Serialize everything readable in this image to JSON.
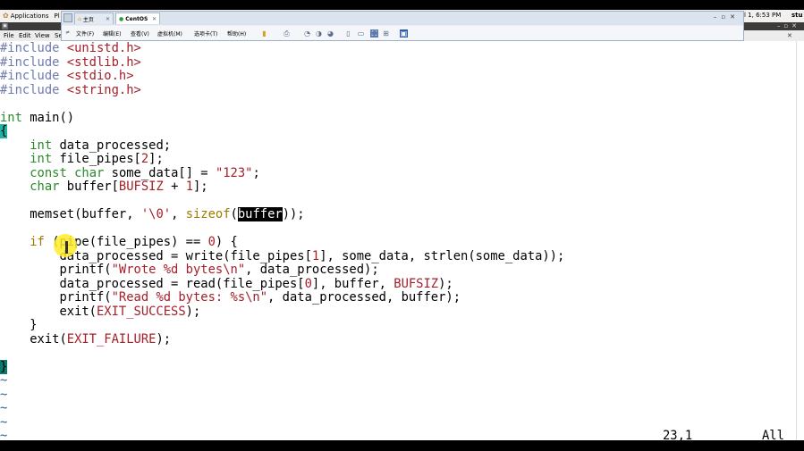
{
  "gnome_panel": {
    "applications": "Applications",
    "places_fragment": "Pl",
    "clock": "l 1, 6:53 PM",
    "user": "stu"
  },
  "terminal": {
    "menubar": {
      "file": "File",
      "edit": "Edit",
      "view": "View",
      "search_fragment": "Se"
    }
  },
  "vm": {
    "tabs": [
      {
        "label": "主页"
      },
      {
        "label": "CentOS"
      }
    ],
    "menu": {
      "file": "文件(F)",
      "edit": "编辑(E)",
      "view": "查看(V)",
      "vm": "虚拟机(M)",
      "tabs": "选项卡(T)",
      "help": "帮助(H)"
    }
  },
  "editor": {
    "lines": [
      {
        "parts": [
          {
            "t": "#include ",
            "c": "pp"
          },
          {
            "t": "<unistd.h>",
            "c": "inc"
          }
        ]
      },
      {
        "parts": [
          {
            "t": "#include ",
            "c": "pp"
          },
          {
            "t": "<stdlib.h>",
            "c": "inc"
          }
        ]
      },
      {
        "parts": [
          {
            "t": "#include ",
            "c": "pp"
          },
          {
            "t": "<stdio.h>",
            "c": "inc"
          }
        ]
      },
      {
        "parts": [
          {
            "t": "#include ",
            "c": "pp"
          },
          {
            "t": "<string.h>",
            "c": "inc"
          }
        ]
      },
      {
        "parts": []
      },
      {
        "parts": [
          {
            "t": "int",
            "c": "ty"
          },
          {
            "t": " main()",
            "c": ""
          }
        ]
      },
      {
        "parts": [
          {
            "t": "{",
            "c": "cursor-block"
          }
        ]
      },
      {
        "parts": [
          {
            "t": "    ",
            "c": ""
          },
          {
            "t": "int",
            "c": "ty"
          },
          {
            "t": " data_processed;",
            "c": ""
          }
        ]
      },
      {
        "parts": [
          {
            "t": "    ",
            "c": ""
          },
          {
            "t": "int",
            "c": "ty"
          },
          {
            "t": " file_pipes[",
            "c": ""
          },
          {
            "t": "2",
            "c": "nm"
          },
          {
            "t": "];",
            "c": ""
          }
        ]
      },
      {
        "parts": [
          {
            "t": "    ",
            "c": ""
          },
          {
            "t": "const",
            "c": "ty"
          },
          {
            "t": " ",
            "c": ""
          },
          {
            "t": "char",
            "c": "ty"
          },
          {
            "t": " some_data[] = ",
            "c": ""
          },
          {
            "t": "\"123\"",
            "c": "st"
          },
          {
            "t": ";",
            "c": ""
          }
        ]
      },
      {
        "parts": [
          {
            "t": "    ",
            "c": ""
          },
          {
            "t": "char",
            "c": "ty"
          },
          {
            "t": " buffer[",
            "c": ""
          },
          {
            "t": "BUFSIZ",
            "c": "mac"
          },
          {
            "t": " + ",
            "c": ""
          },
          {
            "t": "1",
            "c": "nm"
          },
          {
            "t": "];",
            "c": ""
          }
        ]
      },
      {
        "parts": []
      },
      {
        "parts": [
          {
            "t": "    memset(buffer, ",
            "c": ""
          },
          {
            "t": "'\\0'",
            "c": "st"
          },
          {
            "t": ", ",
            "c": ""
          },
          {
            "t": "sizeof",
            "c": "kw"
          },
          {
            "t": "(",
            "c": ""
          },
          {
            "t": "buffer",
            "c": "hl"
          },
          {
            "t": "));",
            "c": ""
          }
        ]
      },
      {
        "parts": []
      },
      {
        "parts": [
          {
            "t": "    ",
            "c": ""
          },
          {
            "t": "if",
            "c": "kw"
          },
          {
            "t": " (pipe(file_pipes) == ",
            "c": ""
          },
          {
            "t": "0",
            "c": "nm"
          },
          {
            "t": ") {",
            "c": ""
          }
        ]
      },
      {
        "parts": [
          {
            "t": "        data_processed = write(file_pipes[",
            "c": ""
          },
          {
            "t": "1",
            "c": "nm"
          },
          {
            "t": "], some_data, strlen(some_data));",
            "c": ""
          }
        ]
      },
      {
        "parts": [
          {
            "t": "        printf(",
            "c": ""
          },
          {
            "t": "\"Wrote %d bytes\\n\"",
            "c": "st"
          },
          {
            "t": ", data_processed);",
            "c": ""
          }
        ]
      },
      {
        "parts": [
          {
            "t": "        data_processed = read(file_pipes[",
            "c": ""
          },
          {
            "t": "0",
            "c": "nm"
          },
          {
            "t": "], buffer, ",
            "c": ""
          },
          {
            "t": "BUFSIZ",
            "c": "mac"
          },
          {
            "t": ");",
            "c": ""
          }
        ]
      },
      {
        "parts": [
          {
            "t": "        printf(",
            "c": ""
          },
          {
            "t": "\"Read %d bytes: %s\\n\"",
            "c": "st"
          },
          {
            "t": ", data_processed, buffer);",
            "c": ""
          }
        ]
      },
      {
        "parts": [
          {
            "t": "        exit(",
            "c": ""
          },
          {
            "t": "EXIT_SUCCESS",
            "c": "mac"
          },
          {
            "t": ");",
            "c": ""
          }
        ]
      },
      {
        "parts": [
          {
            "t": "    }",
            "c": ""
          }
        ]
      },
      {
        "parts": [
          {
            "t": "    exit(",
            "c": ""
          },
          {
            "t": "EXIT_FAILURE",
            "c": "mac"
          },
          {
            "t": ");",
            "c": ""
          }
        ]
      },
      {
        "parts": []
      },
      {
        "parts": [
          {
            "t": "}",
            "c": "cursor-dark-text"
          }
        ]
      },
      {
        "parts": [
          {
            "t": "~",
            "c": "tilde"
          }
        ]
      },
      {
        "parts": [
          {
            "t": "~",
            "c": "tilde"
          }
        ]
      },
      {
        "parts": [
          {
            "t": "~",
            "c": "tilde"
          }
        ]
      },
      {
        "parts": [
          {
            "t": "~",
            "c": "tilde"
          }
        ]
      },
      {
        "parts": [
          {
            "t": "~",
            "c": "tilde"
          }
        ]
      }
    ],
    "status": {
      "position": "23,1",
      "scroll": "All"
    }
  },
  "colors": {
    "preproc": "#6e7bb0",
    "include": "#a5202a",
    "type": "#2b8a2b",
    "keyword": "#a07a00",
    "cursor": "#1fb3a1"
  }
}
